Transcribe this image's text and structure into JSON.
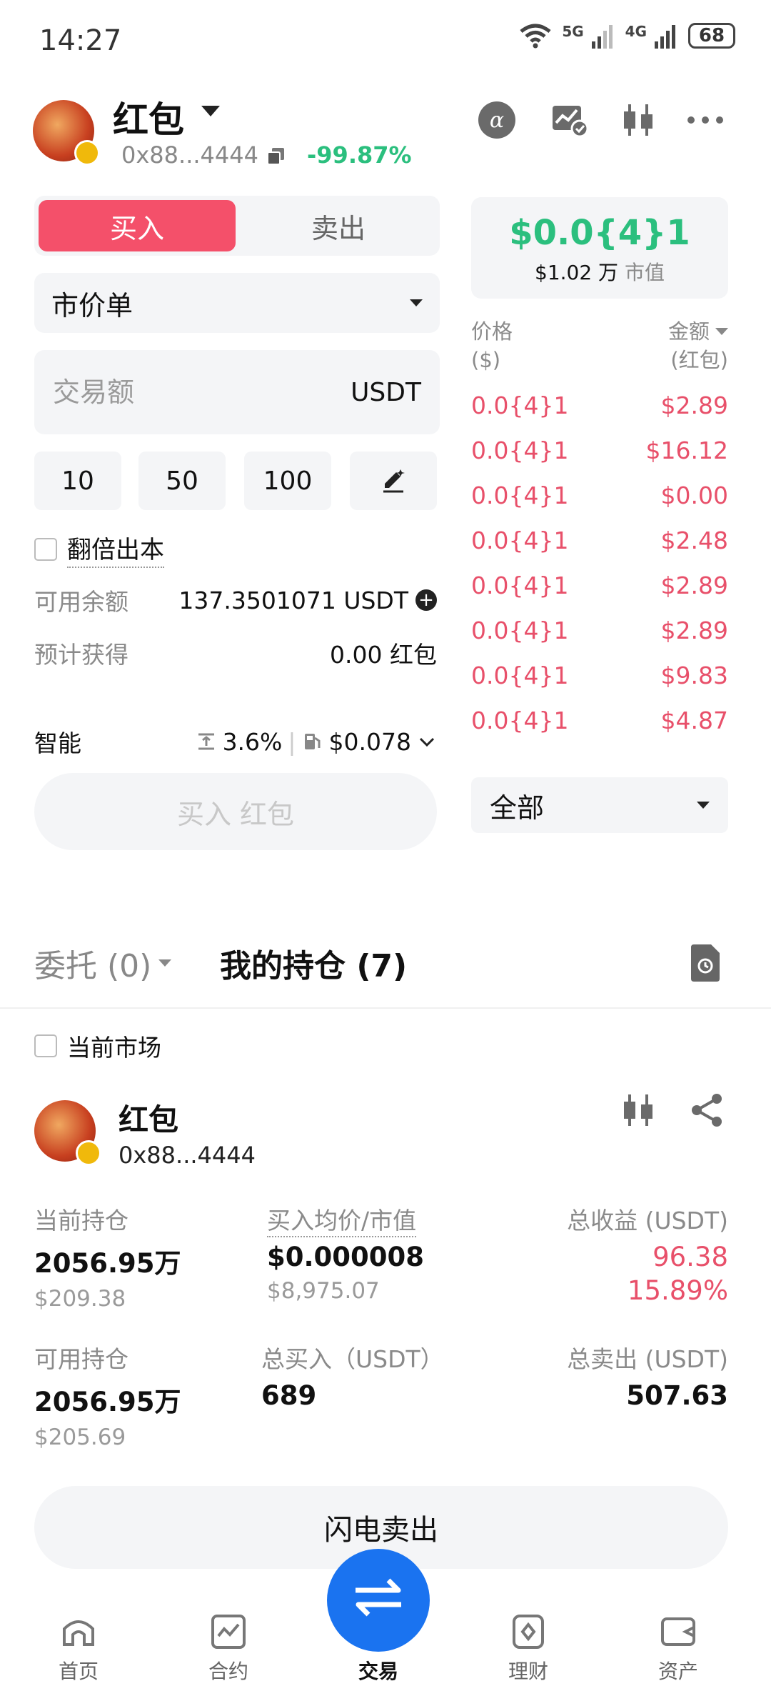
{
  "status_bar": {
    "time": "14:27",
    "net1": "5G",
    "net2": "4G",
    "battery": "68"
  },
  "header": {
    "token_name": "红包",
    "address": "0x88...4444",
    "change_pct": "-99.87%",
    "icons": [
      "alpha-icon",
      "chart-check-icon",
      "candlestick-icon",
      "more-icon"
    ]
  },
  "trade": {
    "tabs": {
      "buy": "买入",
      "sell": "卖出"
    },
    "order_type": "市价单",
    "amount_placeholder": "交易额",
    "amount_unit": "USDT",
    "quick_amounts": [
      "10",
      "50",
      "100"
    ],
    "double_principal": "翻倍出本",
    "available_label": "可用余额",
    "available_value": "137.3501071 USDT",
    "expected_label": "预计获得",
    "expected_value": "0.00 红包",
    "smart_label": "智能",
    "slippage": "3.6%",
    "gas": "$0.078",
    "buy_button": "买入 红包"
  },
  "price_card": {
    "price": "$0.0{4}1",
    "mcap_value": "$1.02 万",
    "mcap_label": "市值"
  },
  "orderbook": {
    "price_header_1": "价格",
    "price_header_2": "($)",
    "amount_header_1": "金额",
    "amount_header_2": "(红包)",
    "rows": [
      {
        "price": "0.0{4}1",
        "amount": "$2.89"
      },
      {
        "price": "0.0{4}1",
        "amount": "$16.12"
      },
      {
        "price": "0.0{4}1",
        "amount": "$0.00"
      },
      {
        "price": "0.0{4}1",
        "amount": "$2.48"
      },
      {
        "price": "0.0{4}1",
        "amount": "$2.89"
      },
      {
        "price": "0.0{4}1",
        "amount": "$2.89"
      },
      {
        "price": "0.0{4}1",
        "amount": "$9.83"
      },
      {
        "price": "0.0{4}1",
        "amount": "$4.87"
      }
    ],
    "depth_select": "全部"
  },
  "bottom_tabs": {
    "orders": "委托 (0)",
    "holdings": "我的持仓 (7)"
  },
  "current_market": "当前市场",
  "position": {
    "name": "红包",
    "address": "0x88...4444",
    "holding_label": "当前持仓",
    "holding_value": "2056.95万",
    "holding_usd": "$209.38",
    "avg_label": "买入均价/市值",
    "avg_price": "$0.000008",
    "avg_mcap": "$8,975.07",
    "pnl_label": "总收益 (USDT)",
    "pnl_value": "96.38",
    "pnl_pct": "15.89%",
    "avail_label": "可用持仓",
    "avail_value": "2056.95万",
    "avail_usd": "$205.69",
    "total_buy_label": "总买入（USDT）",
    "total_buy_value": "689",
    "total_sell_label": "总卖出 (USDT)",
    "total_sell_value": "507.63"
  },
  "flash_sell": "闪电卖出",
  "nav": {
    "home": "首页",
    "futures": "合约",
    "trade": "交易",
    "earn": "理财",
    "assets": "资产"
  },
  "colors": {
    "buy": "#f4506a",
    "up": "#2bbf7e",
    "down": "#e8506a",
    "accent": "#1a73f0"
  }
}
